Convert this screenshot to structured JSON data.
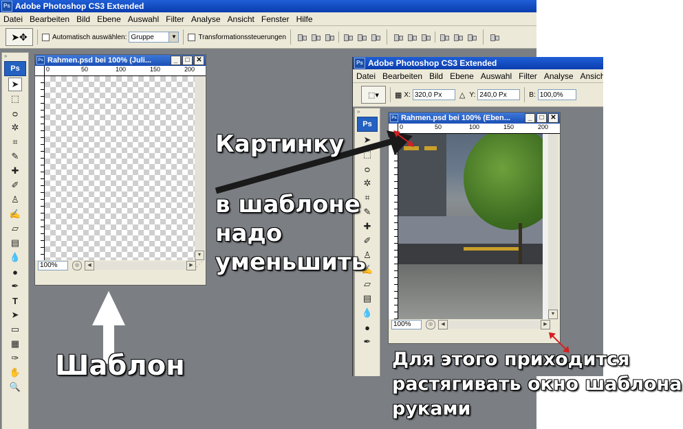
{
  "main_window": {
    "title": "Adobe Photoshop CS3 Extended",
    "menu": [
      "Datei",
      "Bearbeiten",
      "Bild",
      "Ebene",
      "Auswahl",
      "Filter",
      "Analyse",
      "Ansicht",
      "Fenster",
      "Hilfe"
    ],
    "options": {
      "auto_select_label": "Automatisch auswählen:",
      "auto_select_value": "Gruppe",
      "transform_label": "Transformationssteuerungen"
    },
    "toolbox_logo": "Ps",
    "doc": {
      "title": "Rahmen.psd bei 100% (Juli...",
      "ruler_ticks": [
        "0",
        "50",
        "100",
        "150",
        "200"
      ],
      "zoom": "100%"
    }
  },
  "second_window": {
    "title": "Adobe Photoshop CS3 Extended",
    "menu": [
      "Datei",
      "Bearbeiten",
      "Bild",
      "Ebene",
      "Auswahl",
      "Filter",
      "Analyse",
      "Ansicht"
    ],
    "options": {
      "x_label": "X:",
      "x_value": "320,0 Px",
      "y_label": "Y:",
      "y_value": "240,0 Px",
      "w_label": "B:",
      "w_value": "100,0%"
    },
    "toolbox_logo": "Ps",
    "doc": {
      "title": "Rahmen.psd bei 100% (Eben...",
      "ruler_ticks": [
        "0",
        "50",
        "100",
        "150",
        "200"
      ],
      "zoom": "100%"
    }
  },
  "annotations": {
    "picture_label": "Картинку",
    "in_template": "в шаблоне",
    "must": "надо",
    "shrink": "уменьшить",
    "template_label": "Шаблон",
    "note_line1": "Для этого приходится",
    "note_line2": "растягивать окно шаблона",
    "note_line3": "руками"
  },
  "colors": {
    "workspace": "#7b7f84",
    "titlebar": "#0a3dae",
    "arrow": "#1a1a1a",
    "marker": "#d42020"
  }
}
